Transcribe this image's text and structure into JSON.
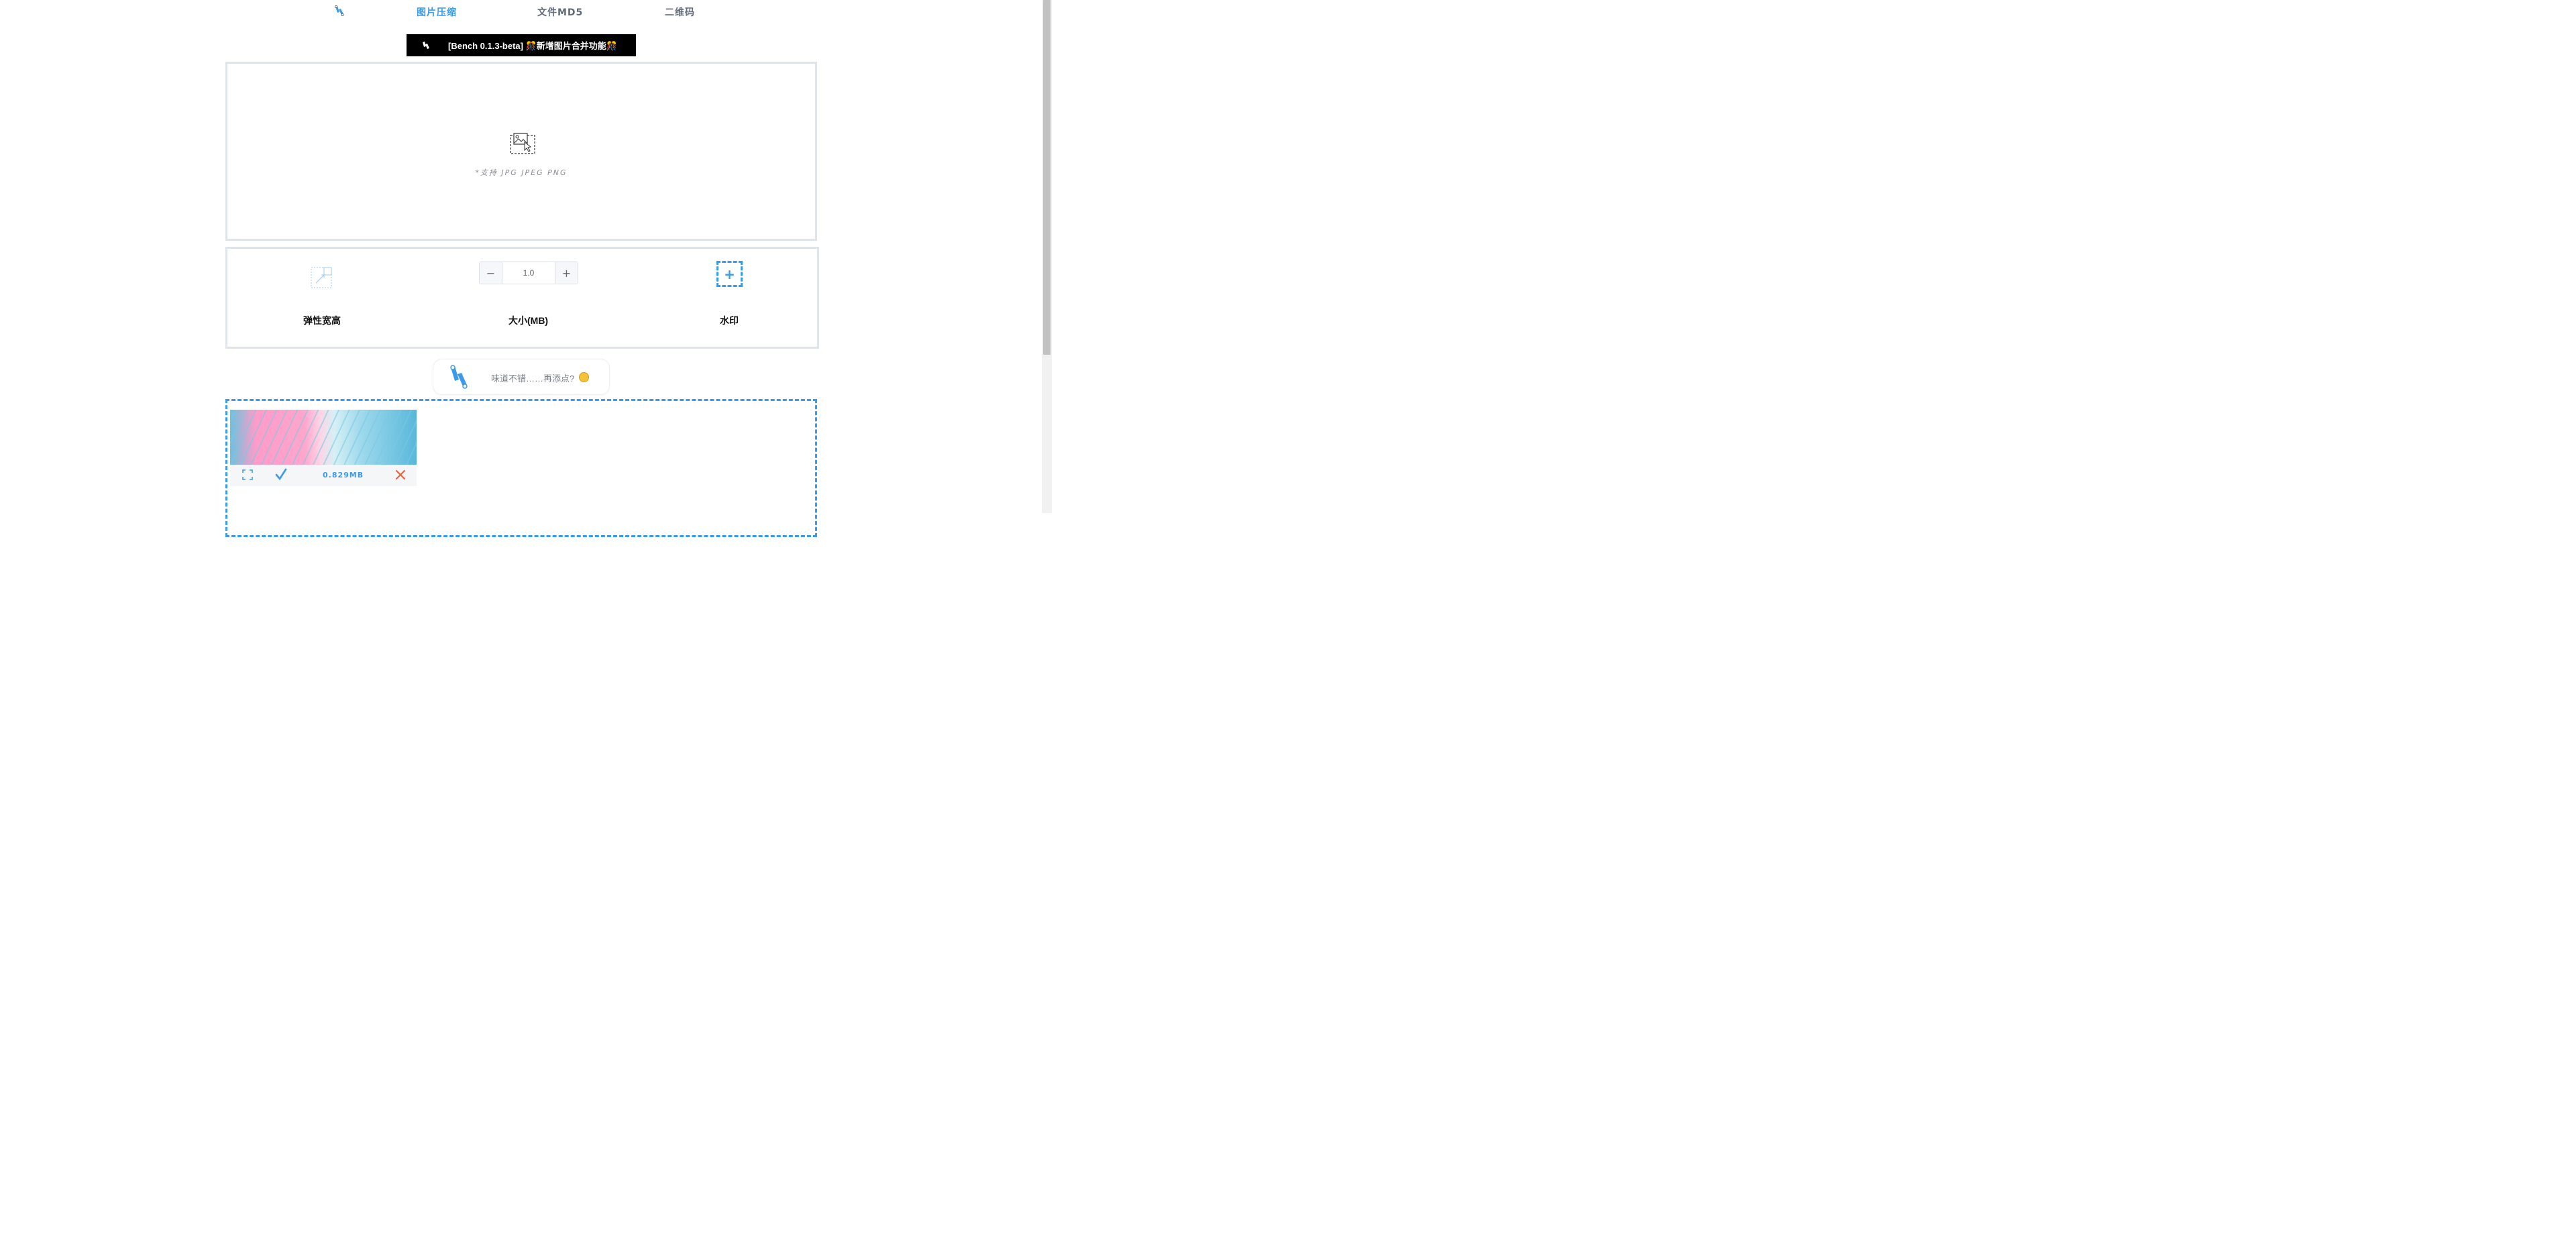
{
  "nav": {
    "items": [
      {
        "label": "图片压缩",
        "active": true
      },
      {
        "label": "文件MD5",
        "active": false
      },
      {
        "label": "二维码",
        "active": false
      }
    ]
  },
  "banner": {
    "text": "[Bench 0.1.3-beta] 🎊新增图片合并功能🎊"
  },
  "upload": {
    "hint": "*支持 JPG JPEG PNG"
  },
  "options": {
    "resize_label": "弹性宽高",
    "size_label": "大小(MB)",
    "size_value": "1.0",
    "watermark_label": "水印"
  },
  "tip": {
    "text": "味道不错……再添点?"
  },
  "results": {
    "items": [
      {
        "size": "0.829MB"
      }
    ]
  },
  "colors": {
    "accent": "#3b9be8",
    "border": "#dfe3ea",
    "close": "#e8683e"
  }
}
